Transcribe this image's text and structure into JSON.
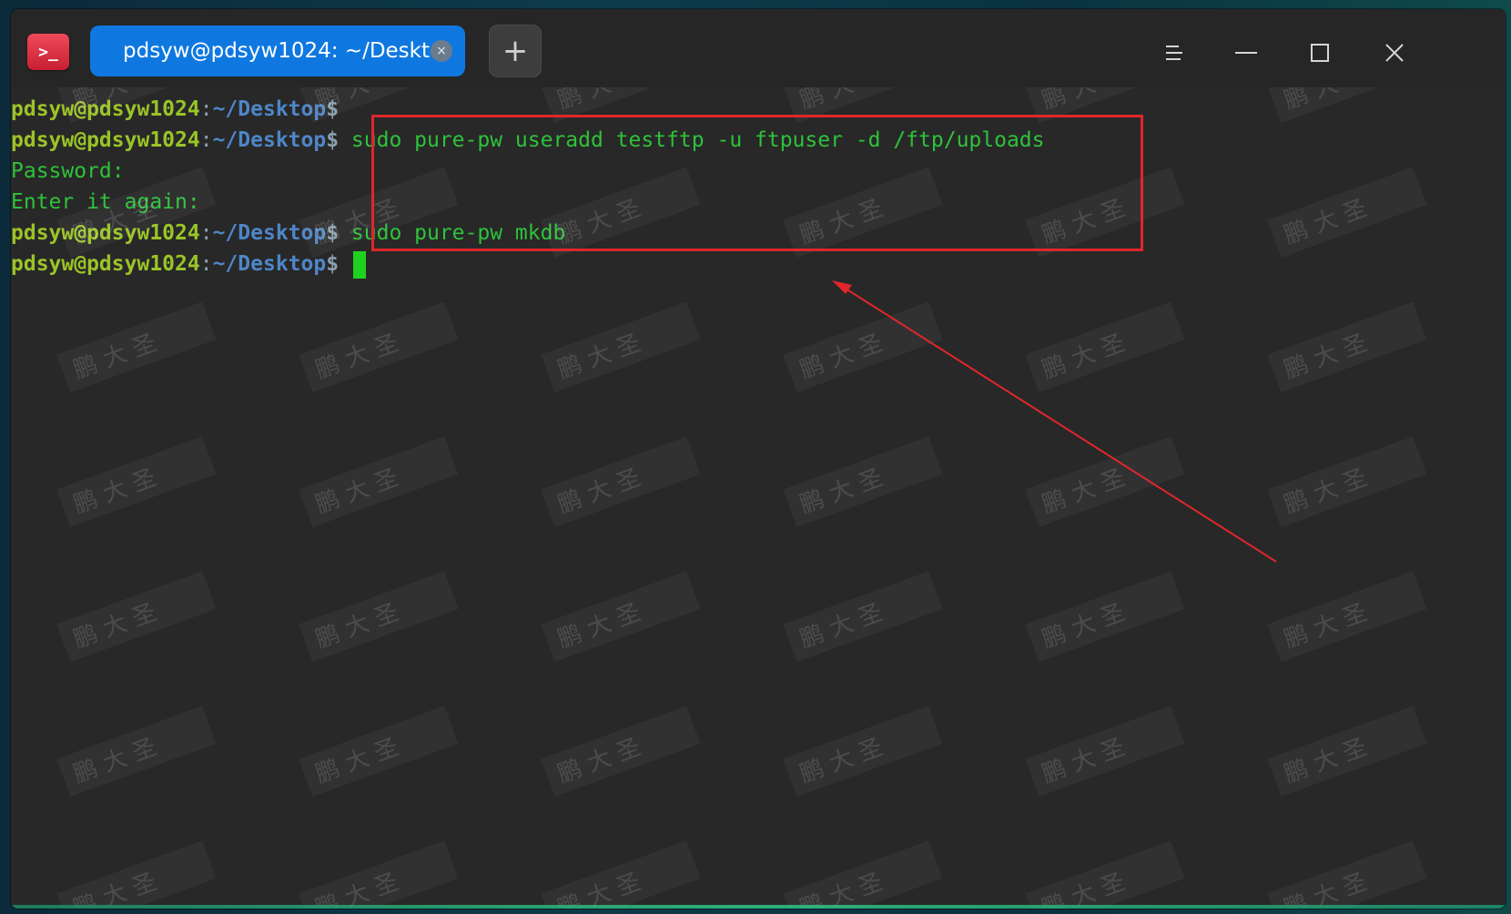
{
  "window": {
    "tab_title": "pdsyw@pdsyw1024: ~/Desktop",
    "tab_close_glyph": "×",
    "new_tab_glyph": "+"
  },
  "icons": {
    "app": "terminal-app-icon",
    "menu": "hamburger-menu-icon",
    "minimize": "minimize-icon",
    "maximize": "maximize-icon",
    "close": "close-icon"
  },
  "terminal": {
    "prompt_user": "pdsyw@pdsyw1024",
    "prompt_colon": ":",
    "prompt_path": "~/Desktop",
    "prompt_dollar": "$",
    "lines": [
      {
        "type": "prompt",
        "command": ""
      },
      {
        "type": "prompt",
        "command": "sudo pure-pw useradd testftp -u ftpuser -d /ftp/uploads"
      },
      {
        "type": "output",
        "text": "Password:"
      },
      {
        "type": "output",
        "text": "Enter it again:"
      },
      {
        "type": "prompt",
        "command": "sudo pure-pw mkdb"
      },
      {
        "type": "prompt",
        "command": ""
      }
    ]
  },
  "annotation": {
    "box_color": "#e0262b",
    "arrow_color": "#e0262b"
  },
  "watermark": {
    "text": "鹏 大 圣"
  },
  "colors": {
    "tab_active": "#0f78e0",
    "prompt_user": "#9ac427",
    "prompt_path": "#4e86c7",
    "command_text": "#2ec23a",
    "cursor": "#1fd11f",
    "terminal_bg": "#282828"
  }
}
